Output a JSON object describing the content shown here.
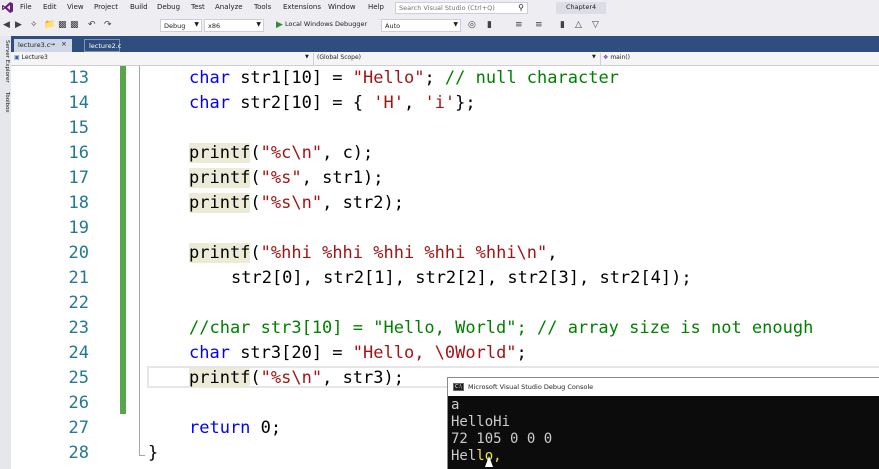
{
  "menu": {
    "items": [
      "File",
      "Edit",
      "View",
      "Project",
      "Build",
      "Debug",
      "Test",
      "Analyze",
      "Tools",
      "Extensions",
      "Window",
      "Help"
    ],
    "search_placeholder": "Search Visual Studio (Ctrl+Q)",
    "solution_name": "Chapter4"
  },
  "toolbar": {
    "configuration": "Debug",
    "platform": "x86",
    "run_label": "Local Windows Debugger",
    "target": "Auto"
  },
  "side_panels": [
    "Server Explorer",
    "Toolbox"
  ],
  "tabs": [
    {
      "label": "lecture3.c",
      "active": true
    },
    {
      "label": "lecture2.c",
      "active": false
    }
  ],
  "navbar": {
    "project": "Lecture3",
    "scope": "(Global Scope)",
    "member": "main()"
  },
  "editor": {
    "lines": [
      {
        "num": "13",
        "tokens": [
          {
            "t": "char",
            "c": "kw"
          },
          {
            "t": " str1[10] = ",
            "c": ""
          },
          {
            "t": "\"Hello\"",
            "c": "str"
          },
          {
            "t": "; ",
            "c": ""
          },
          {
            "t": "// null character",
            "c": "cmt"
          }
        ]
      },
      {
        "num": "14",
        "tokens": [
          {
            "t": "char",
            "c": "kw"
          },
          {
            "t": " str2[10] = { ",
            "c": ""
          },
          {
            "t": "'H'",
            "c": "str"
          },
          {
            "t": ", ",
            "c": ""
          },
          {
            "t": "'i'",
            "c": "str"
          },
          {
            "t": "};",
            "c": ""
          }
        ]
      },
      {
        "num": "15",
        "tokens": []
      },
      {
        "num": "16",
        "tokens": [
          {
            "t": "printf",
            "c": "fn"
          },
          {
            "t": "(",
            "c": ""
          },
          {
            "t": "\"%c\\n\"",
            "c": "str"
          },
          {
            "t": ", c);",
            "c": ""
          }
        ]
      },
      {
        "num": "17",
        "tokens": [
          {
            "t": "printf",
            "c": "fn"
          },
          {
            "t": "(",
            "c": ""
          },
          {
            "t": "\"%s\"",
            "c": "str"
          },
          {
            "t": ", str1);",
            "c": ""
          }
        ]
      },
      {
        "num": "18",
        "tokens": [
          {
            "t": "printf",
            "c": "fn"
          },
          {
            "t": "(",
            "c": ""
          },
          {
            "t": "\"%s\\n\"",
            "c": "str"
          },
          {
            "t": ", str2);",
            "c": ""
          }
        ]
      },
      {
        "num": "19",
        "tokens": []
      },
      {
        "num": "20",
        "tokens": [
          {
            "t": "printf",
            "c": "fn"
          },
          {
            "t": "(",
            "c": ""
          },
          {
            "t": "\"%hhi %hhi %hhi %hhi %hhi\\n\"",
            "c": "str"
          },
          {
            "t": ",",
            "c": ""
          }
        ]
      },
      {
        "num": "21",
        "indent": 2,
        "tokens": [
          {
            "t": "str2[0], str2[1], str2[2], str2[3], str2[4]);",
            "c": ""
          }
        ]
      },
      {
        "num": "22",
        "tokens": []
      },
      {
        "num": "23",
        "tokens": [
          {
            "t": "//char str3[10] = \"Hello, World\"; // array size is not enough",
            "c": "cmt"
          }
        ]
      },
      {
        "num": "24",
        "tokens": [
          {
            "t": "char",
            "c": "kw"
          },
          {
            "t": " str3[20] = ",
            "c": ""
          },
          {
            "t": "\"Hello, \\0World\"",
            "c": "str"
          },
          {
            "t": ";",
            "c": ""
          }
        ]
      },
      {
        "num": "25",
        "tokens": [
          {
            "t": "printf",
            "c": "fn"
          },
          {
            "t": "(",
            "c": ""
          },
          {
            "t": "\"%s\\n\"",
            "c": "str"
          },
          {
            "t": ", str3);",
            "c": ""
          }
        ]
      },
      {
        "num": "26",
        "tokens": []
      },
      {
        "num": "27",
        "tokens": [
          {
            "t": "return",
            "c": "kw"
          },
          {
            "t": " 0;",
            "c": ""
          }
        ]
      },
      {
        "num": "28",
        "indent": 0,
        "tokens": [
          {
            "t": "}",
            "c": ""
          }
        ]
      }
    ]
  },
  "console": {
    "title": "Microsoft Visual Studio Debug Console",
    "lines": [
      "a",
      "HelloHi",
      "72 105 0 0 0"
    ],
    "last_line_start": "Hel",
    "last_line_highlight": "lo,"
  },
  "colors": {
    "keyword": "#0000ff",
    "string": "#a31515",
    "comment": "#008000",
    "line_number": "#237893",
    "change_bar": "#57a64a",
    "tab_row": "#2f4d7e"
  }
}
